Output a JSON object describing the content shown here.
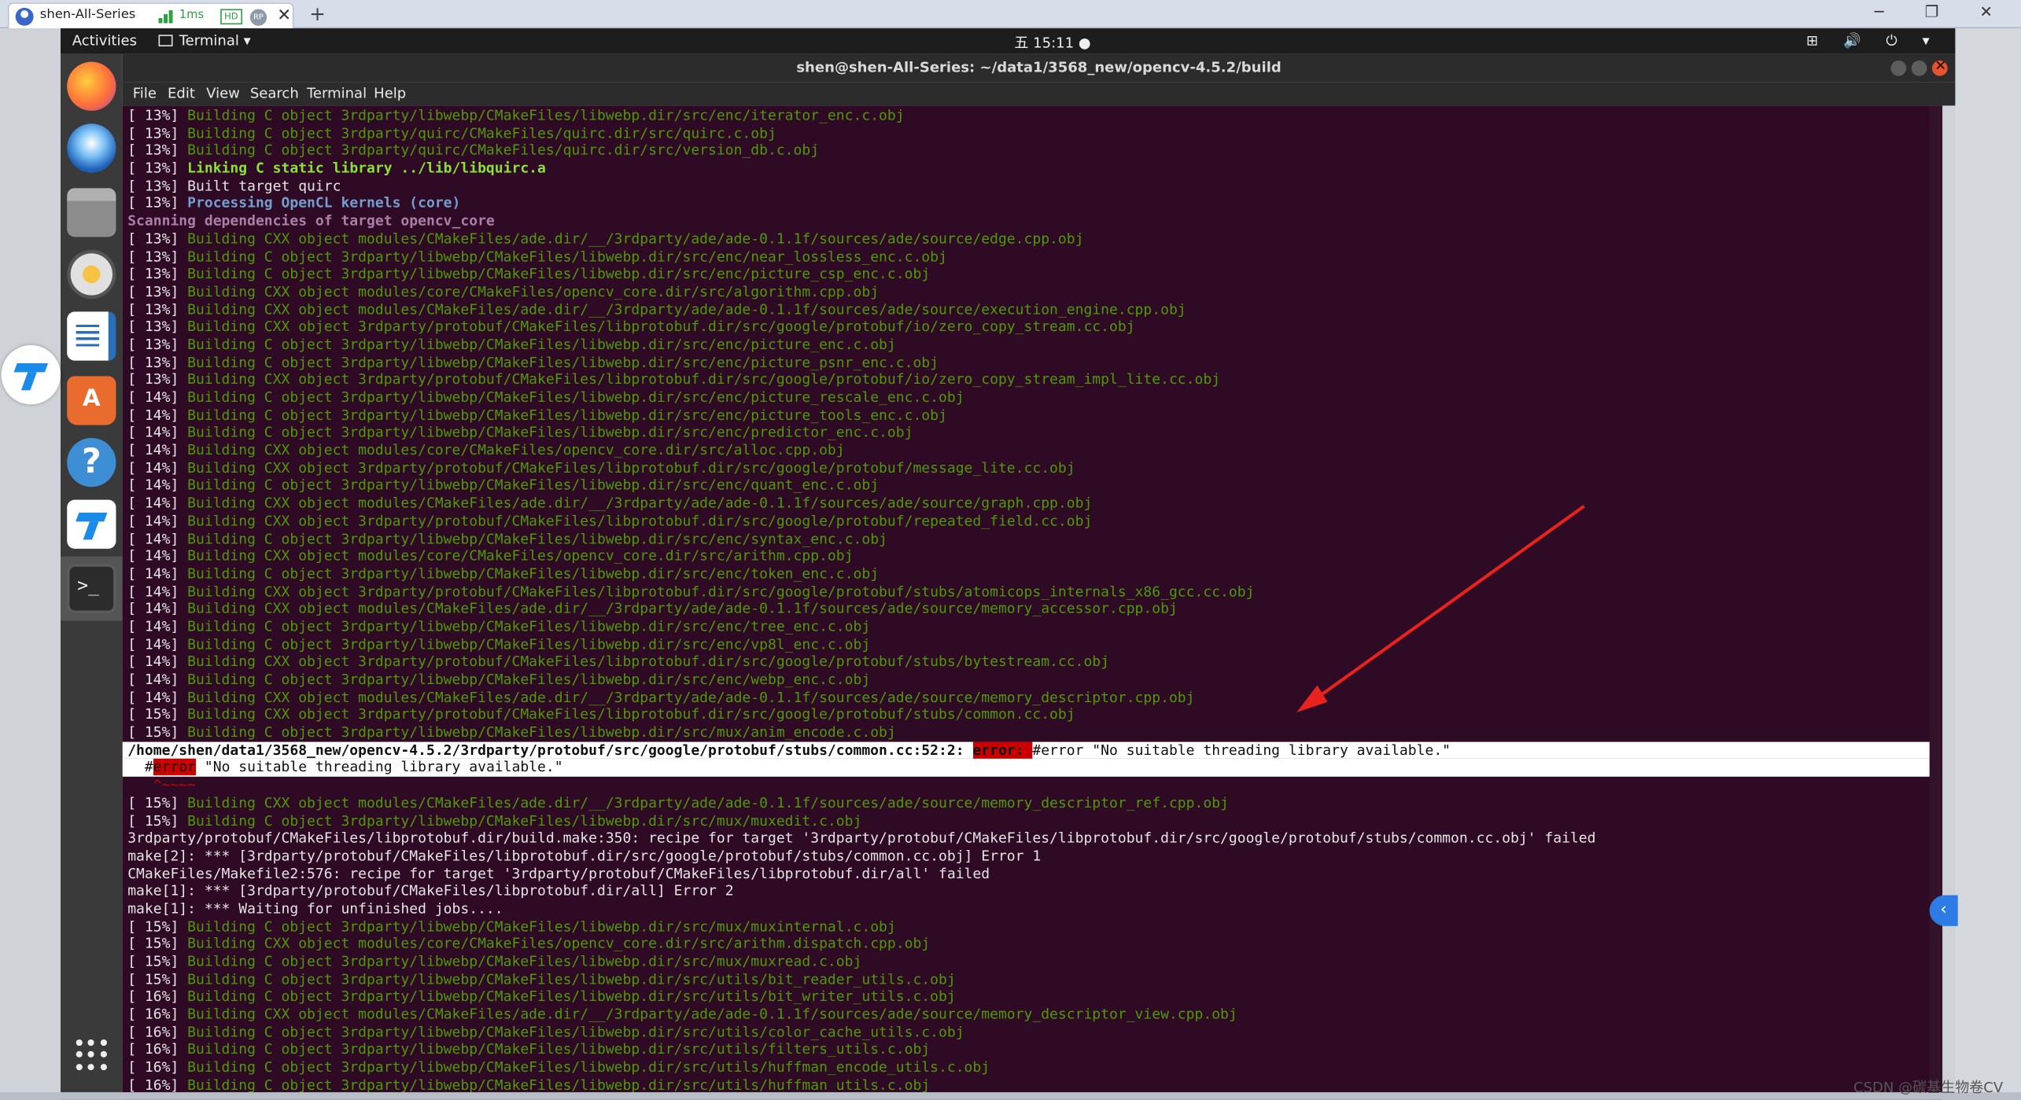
{
  "host": {
    "tab_title": "shen-All-Series",
    "latency": "1ms",
    "hd_badge": "HD",
    "rp_badge": "RP",
    "close_glyph": "✕",
    "new_tab_glyph": "+",
    "window_controls": "─ ❐ ✕"
  },
  "topbar": {
    "activities": "Activities",
    "app_menu": "Terminal ▾",
    "clock": "五 15:11 ●",
    "tray": "⊞ 🔊 ⏻ ▾"
  },
  "window": {
    "title": "shen@shen-All-Series: ~/data1/3568_new/opencv-4.5.2/build"
  },
  "menu": [
    "File",
    "Edit",
    "View",
    "Search",
    "Terminal",
    "Help"
  ],
  "terminal": {
    "lines": [
      {
        "p": "[ 13%] ",
        "t": "Building C object 3rdparty/libwebp/CMakeFiles/libwebp.dir/src/enc/iterator_enc.c.obj",
        "c": "build"
      },
      {
        "p": "[ 13%] ",
        "t": "Building C object 3rdparty/quirc/CMakeFiles/quirc.dir/src/quirc.c.obj",
        "c": "build"
      },
      {
        "p": "[ 13%] ",
        "t": "Building C object 3rdparty/quirc/CMakeFiles/quirc.dir/src/version_db.c.obj",
        "c": "build"
      },
      {
        "p": "[ 13%] ",
        "t": "Linking C static library ../lib/libquirc.a",
        "c": "link bold"
      },
      {
        "p": "[ 13%] ",
        "t": "Built target quirc",
        "c": ""
      },
      {
        "p": "[ 13%] ",
        "t": "Processing OpenCL kernels (core)",
        "c": "proc bold"
      },
      {
        "p": "",
        "t": "Scanning dependencies of target opencv_core",
        "c": "scan bold"
      },
      {
        "p": "[ 13%] ",
        "t": "Building CXX object modules/CMakeFiles/ade.dir/__/3rdparty/ade/ade-0.1.1f/sources/ade/source/edge.cpp.obj",
        "c": "build"
      },
      {
        "p": "[ 13%] ",
        "t": "Building C object 3rdparty/libwebp/CMakeFiles/libwebp.dir/src/enc/near_lossless_enc.c.obj",
        "c": "build"
      },
      {
        "p": "[ 13%] ",
        "t": "Building C object 3rdparty/libwebp/CMakeFiles/libwebp.dir/src/enc/picture_csp_enc.c.obj",
        "c": "build"
      },
      {
        "p": "[ 13%] ",
        "t": "Building CXX object modules/core/CMakeFiles/opencv_core.dir/src/algorithm.cpp.obj",
        "c": "build"
      },
      {
        "p": "[ 13%] ",
        "t": "Building CXX object modules/CMakeFiles/ade.dir/__/3rdparty/ade/ade-0.1.1f/sources/ade/source/execution_engine.cpp.obj",
        "c": "build"
      },
      {
        "p": "[ 13%] ",
        "t": "Building CXX object 3rdparty/protobuf/CMakeFiles/libprotobuf.dir/src/google/protobuf/io/zero_copy_stream.cc.obj",
        "c": "build"
      },
      {
        "p": "[ 13%] ",
        "t": "Building C object 3rdparty/libwebp/CMakeFiles/libwebp.dir/src/enc/picture_enc.c.obj",
        "c": "build"
      },
      {
        "p": "[ 13%] ",
        "t": "Building C object 3rdparty/libwebp/CMakeFiles/libwebp.dir/src/enc/picture_psnr_enc.c.obj",
        "c": "build"
      },
      {
        "p": "[ 13%] ",
        "t": "Building CXX object 3rdparty/protobuf/CMakeFiles/libprotobuf.dir/src/google/protobuf/io/zero_copy_stream_impl_lite.cc.obj",
        "c": "build"
      },
      {
        "p": "[ 14%] ",
        "t": "Building C object 3rdparty/libwebp/CMakeFiles/libwebp.dir/src/enc/picture_rescale_enc.c.obj",
        "c": "build"
      },
      {
        "p": "[ 14%] ",
        "t": "Building C object 3rdparty/libwebp/CMakeFiles/libwebp.dir/src/enc/picture_tools_enc.c.obj",
        "c": "build"
      },
      {
        "p": "[ 14%] ",
        "t": "Building C object 3rdparty/libwebp/CMakeFiles/libwebp.dir/src/enc/predictor_enc.c.obj",
        "c": "build"
      },
      {
        "p": "[ 14%] ",
        "t": "Building CXX object modules/core/CMakeFiles/opencv_core.dir/src/alloc.cpp.obj",
        "c": "build"
      },
      {
        "p": "[ 14%] ",
        "t": "Building CXX object 3rdparty/protobuf/CMakeFiles/libprotobuf.dir/src/google/protobuf/message_lite.cc.obj",
        "c": "build"
      },
      {
        "p": "[ 14%] ",
        "t": "Building C object 3rdparty/libwebp/CMakeFiles/libwebp.dir/src/enc/quant_enc.c.obj",
        "c": "build"
      },
      {
        "p": "[ 14%] ",
        "t": "Building CXX object modules/CMakeFiles/ade.dir/__/3rdparty/ade/ade-0.1.1f/sources/ade/source/graph.cpp.obj",
        "c": "build"
      },
      {
        "p": "[ 14%] ",
        "t": "Building CXX object 3rdparty/protobuf/CMakeFiles/libprotobuf.dir/src/google/protobuf/repeated_field.cc.obj",
        "c": "build"
      },
      {
        "p": "[ 14%] ",
        "t": "Building C object 3rdparty/libwebp/CMakeFiles/libwebp.dir/src/enc/syntax_enc.c.obj",
        "c": "build"
      },
      {
        "p": "[ 14%] ",
        "t": "Building CXX object modules/core/CMakeFiles/opencv_core.dir/src/arithm.cpp.obj",
        "c": "build"
      },
      {
        "p": "[ 14%] ",
        "t": "Building C object 3rdparty/libwebp/CMakeFiles/libwebp.dir/src/enc/token_enc.c.obj",
        "c": "build"
      },
      {
        "p": "[ 14%] ",
        "t": "Building CXX object 3rdparty/protobuf/CMakeFiles/libprotobuf.dir/src/google/protobuf/stubs/atomicops_internals_x86_gcc.cc.obj",
        "c": "build"
      },
      {
        "p": "[ 14%] ",
        "t": "Building CXX object modules/CMakeFiles/ade.dir/__/3rdparty/ade/ade-0.1.1f/sources/ade/source/memory_accessor.cpp.obj",
        "c": "build"
      },
      {
        "p": "[ 14%] ",
        "t": "Building C object 3rdparty/libwebp/CMakeFiles/libwebp.dir/src/enc/tree_enc.c.obj",
        "c": "build"
      },
      {
        "p": "[ 14%] ",
        "t": "Building C object 3rdparty/libwebp/CMakeFiles/libwebp.dir/src/enc/vp8l_enc.c.obj",
        "c": "build"
      },
      {
        "p": "[ 14%] ",
        "t": "Building CXX object 3rdparty/protobuf/CMakeFiles/libprotobuf.dir/src/google/protobuf/stubs/bytestream.cc.obj",
        "c": "build"
      },
      {
        "p": "[ 14%] ",
        "t": "Building C object 3rdparty/libwebp/CMakeFiles/libwebp.dir/src/enc/webp_enc.c.obj",
        "c": "build"
      },
      {
        "p": "[ 14%] ",
        "t": "Building CXX object modules/CMakeFiles/ade.dir/__/3rdparty/ade/ade-0.1.1f/sources/ade/source/memory_descriptor.cpp.obj",
        "c": "build"
      },
      {
        "p": "[ 15%] ",
        "t": "Building CXX object 3rdparty/protobuf/CMakeFiles/libprotobuf.dir/src/google/protobuf/stubs/common.cc.obj",
        "c": "build"
      },
      {
        "p": "[ 15%] ",
        "t": "Building C object 3rdparty/libwebp/CMakeFiles/libwebp.dir/src/mux/anim_encode.c.obj",
        "c": "build"
      }
    ],
    "error_line": {
      "path": "/home/shen/data1/3568_new/opencv-4.5.2/3rdparty/protobuf/src/google/protobuf/stubs/common.cc:52:2: ",
      "tag": "error: ",
      "msg": "#error \"No suitable threading library available.\""
    },
    "error_source": {
      "indent": "  #",
      "tag": "error",
      "msg": " \"No suitable threading library available.\""
    },
    "caret": "   ^~~~~",
    "lines_after": [
      {
        "p": "[ 15%] ",
        "t": "Building CXX object modules/CMakeFiles/ade.dir/__/3rdparty/ade/ade-0.1.1f/sources/ade/source/memory_descriptor_ref.cpp.obj",
        "c": "build"
      },
      {
        "p": "[ 15%] ",
        "t": "Building C object 3rdparty/libwebp/CMakeFiles/libwebp.dir/src/mux/muxedit.c.obj",
        "c": "build"
      },
      {
        "p": "",
        "t": "3rdparty/protobuf/CMakeFiles/libprotobuf.dir/build.make:350: recipe for target '3rdparty/protobuf/CMakeFiles/libprotobuf.dir/src/google/protobuf/stubs/common.cc.obj' failed",
        "c": ""
      },
      {
        "p": "",
        "t": "make[2]: *** [3rdparty/protobuf/CMakeFiles/libprotobuf.dir/src/google/protobuf/stubs/common.cc.obj] Error 1",
        "c": ""
      },
      {
        "p": "",
        "t": "CMakeFiles/Makefile2:576: recipe for target '3rdparty/protobuf/CMakeFiles/libprotobuf.dir/all' failed",
        "c": ""
      },
      {
        "p": "",
        "t": "make[1]: *** [3rdparty/protobuf/CMakeFiles/libprotobuf.dir/all] Error 2",
        "c": ""
      },
      {
        "p": "",
        "t": "make[1]: *** Waiting for unfinished jobs....",
        "c": ""
      },
      {
        "p": "[ 15%] ",
        "t": "Building C object 3rdparty/libwebp/CMakeFiles/libwebp.dir/src/mux/muxinternal.c.obj",
        "c": "build"
      },
      {
        "p": "[ 15%] ",
        "t": "Building CXX object modules/core/CMakeFiles/opencv_core.dir/src/arithm.dispatch.cpp.obj",
        "c": "build"
      },
      {
        "p": "[ 15%] ",
        "t": "Building C object 3rdparty/libwebp/CMakeFiles/libwebp.dir/src/mux/muxread.c.obj",
        "c": "build"
      },
      {
        "p": "[ 15%] ",
        "t": "Building C object 3rdparty/libwebp/CMakeFiles/libwebp.dir/src/utils/bit_reader_utils.c.obj",
        "c": "build"
      },
      {
        "p": "[ 16%] ",
        "t": "Building C object 3rdparty/libwebp/CMakeFiles/libwebp.dir/src/utils/bit_writer_utils.c.obj",
        "c": "build"
      },
      {
        "p": "[ 16%] ",
        "t": "Building CXX object modules/CMakeFiles/ade.dir/__/3rdparty/ade/ade-0.1.1f/sources/ade/source/memory_descriptor_view.cpp.obj",
        "c": "build"
      },
      {
        "p": "[ 16%] ",
        "t": "Building C object 3rdparty/libwebp/CMakeFiles/libwebp.dir/src/utils/color_cache_utils.c.obj",
        "c": "build"
      },
      {
        "p": "[ 16%] ",
        "t": "Building C object 3rdparty/libwebp/CMakeFiles/libwebp.dir/src/utils/filters_utils.c.obj",
        "c": "build"
      },
      {
        "p": "[ 16%] ",
        "t": "Building C object 3rdparty/libwebp/CMakeFiles/libwebp.dir/src/utils/huffman_encode_utils.c.obj",
        "c": "build"
      },
      {
        "p": "[ 16%] ",
        "t": "Building C object 3rdparty/libwebp/CMakeFiles/libwebp.dir/src/utils/huffman_utils.c.obj",
        "c": "build"
      }
    ]
  },
  "colors": {
    "terminal_bg": "#2f0a24",
    "build_green": "#4e9a06",
    "error_red": "#cc0000",
    "arrow_red": "#e8231d"
  },
  "icons": [
    "firefox-icon",
    "thunderbird-icon",
    "files-icon",
    "rhythmbox-icon",
    "writer-icon",
    "software-icon",
    "help-icon",
    "todesk-icon",
    "terminal-icon",
    "show-apps-icon"
  ],
  "watermark": "CSDN @碳基生物卷CV"
}
